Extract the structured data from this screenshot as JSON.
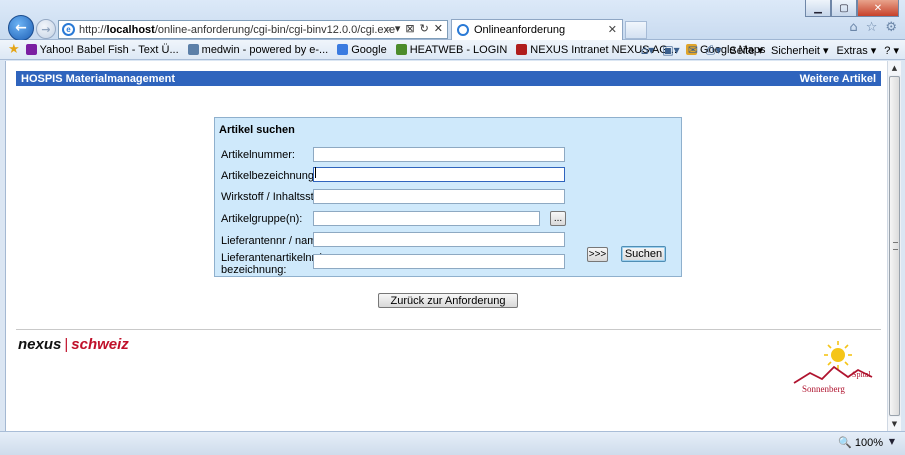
{
  "browser": {
    "url_scheme": "http://",
    "url_host": "localhost",
    "url_path": "/online-anforderung/cgi-bin/cgi-binv12.0.0/cgi.exe",
    "tab_title": "Onlineanforderung",
    "address_tools": [
      "⌕ ▾",
      "⊠",
      "↻",
      "✕"
    ],
    "favorites": [
      {
        "label": "Yahoo! Babel Fish - Text Ü...",
        "color": "#7b1fa2"
      },
      {
        "label": "medwin - powered by e-...",
        "color": "#5b7fa8"
      },
      {
        "label": "Google",
        "color": "#3a7be0"
      },
      {
        "label": "HEATWEB - LOGIN",
        "color": "#4c8c2b"
      },
      {
        "label": "NEXUS Intranet NEXUS AG...",
        "color": "#b01d1d"
      },
      {
        "label": "Google Maps",
        "color": "#e0a52b"
      }
    ],
    "commands": {
      "seite": "Seite ▾",
      "sicherheit": "Sicherheit ▾",
      "extras": "Extras ▾",
      "help": "? ▾"
    },
    "zoom": "100%",
    "window_controls": {
      "minimize": "▁",
      "maximize": "▢",
      "close": "✕"
    }
  },
  "page": {
    "header_left": "HOSPIS Materialmanagement",
    "header_right": "Weitere Artikel",
    "panel_title": "Artikel suchen",
    "fields": {
      "artikelnummer": {
        "label": "Artikelnummer:",
        "value": ""
      },
      "artikelbezeichnung": {
        "label": "Artikelbezeichnung:",
        "value": ""
      },
      "wirkstoff": {
        "label": "Wirkstoff / Inhaltsstoff:",
        "value": ""
      },
      "artikelgruppe": {
        "label": "Artikelgruppe(n):",
        "value": ""
      },
      "lieferant": {
        "label": "Lieferantennr / name:",
        "value": ""
      },
      "lieferantenartikel": {
        "label_line1": "Lieferantenartikelnr /",
        "label_line2": "bezeichnung:",
        "value": ""
      }
    },
    "browse_button": "...",
    "more_button": ">>>",
    "search_button": "Suchen",
    "back_button": "Zurück zur Anforderung",
    "logo_nexus_1": "nexus",
    "logo_nexus_sep": "|",
    "logo_nexus_2": "schweiz",
    "logo_spital_1": "Spital",
    "logo_spital_2": "Sonnenberg"
  }
}
